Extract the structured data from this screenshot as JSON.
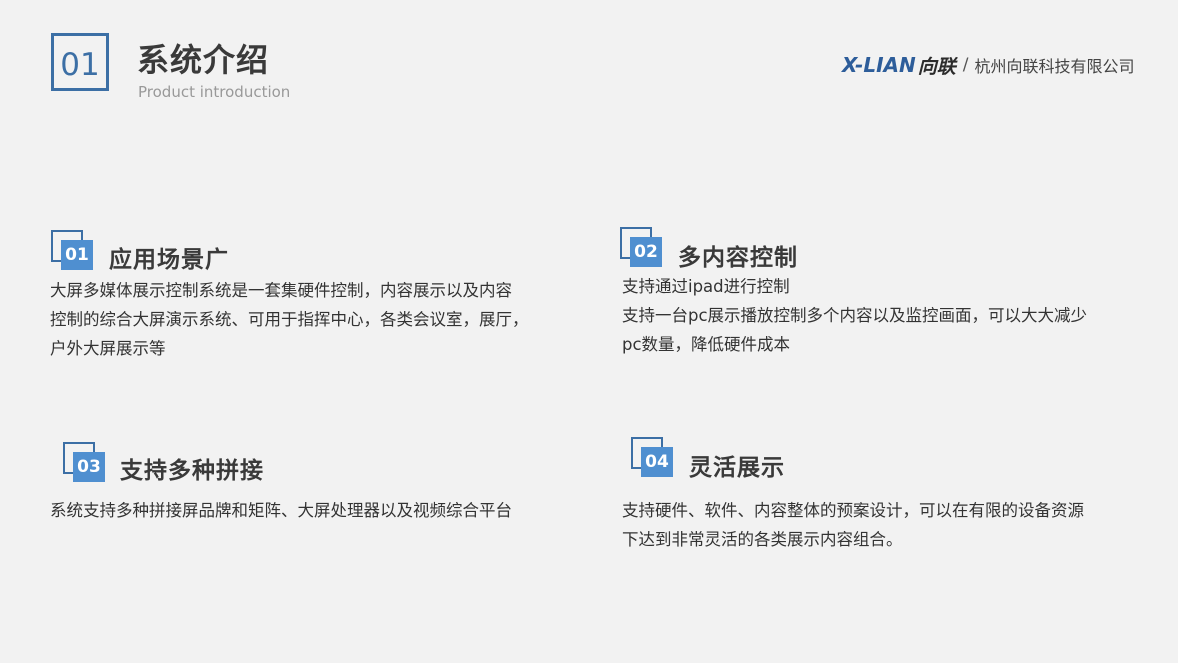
{
  "header": {
    "number": "01",
    "title": "系统介绍",
    "subtitle": "Product introduction"
  },
  "brand": {
    "logo_latin": "X-LIAN",
    "logo_cn": "向联",
    "separator": "/",
    "company": "杭州向联科技有限公司",
    "accent_color": "#2d5d9a"
  },
  "sections": [
    {
      "number": "01",
      "title": "应用场景广",
      "lines": [
        "大屏多媒体展示控制系统是一套集硬件控制，内容展示以及内容",
        "控制的综合大屏演示系统、可用于指挥中心，各类会议室，展厅，",
        "户外大屏展示等"
      ]
    },
    {
      "number": "02",
      "title": "多内容控制",
      "lines": [
        "支持通过ipad进行控制",
        "支持一台pc展示播放控制多个内容以及监控画面，可以大大减少",
        "pc数量，降低硬件成本"
      ]
    },
    {
      "number": "03",
      "title": "支持多种拼接",
      "lines": [
        "系统支持多种拼接屏品牌和矩阵、大屏处理器以及视频综合平台"
      ]
    },
    {
      "number": "04",
      "title": "灵活展示",
      "lines": [
        "支持硬件、软件、内容整体的预案设计，可以在有限的设备资源",
        "下达到非常灵活的各类展示内容组合。"
      ]
    }
  ],
  "colors": {
    "background": "#f2f2f2",
    "accent_dark": "#3c6fa5",
    "accent_fill": "#4f8fd0"
  }
}
